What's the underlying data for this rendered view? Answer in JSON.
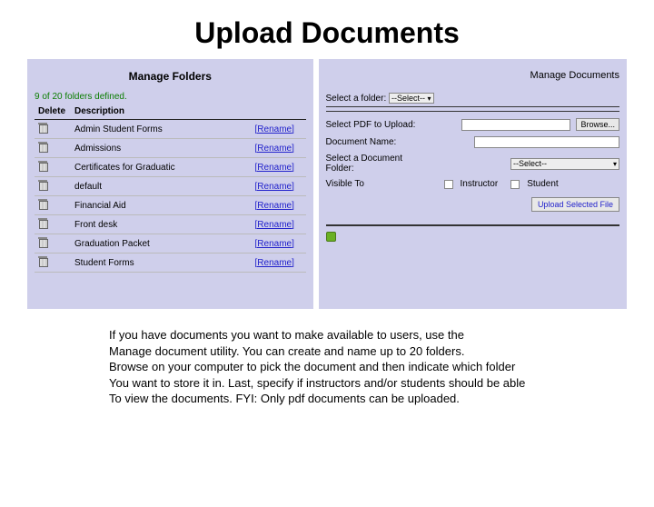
{
  "title": "Upload Documents",
  "left": {
    "heading": "Manage Folders",
    "count_text": "9 of 20 folders defined.",
    "columns": {
      "c0": "Delete",
      "c1": "Description",
      "c2": ""
    },
    "rename_label": "[Rename]",
    "rows": [
      {
        "desc": "Admin Student Forms"
      },
      {
        "desc": "Admissions"
      },
      {
        "desc": "Certificates for Graduatic"
      },
      {
        "desc": "default"
      },
      {
        "desc": "Financial Aid"
      },
      {
        "desc": "Front desk"
      },
      {
        "desc": "Graduation Packet"
      },
      {
        "desc": "Student Forms"
      }
    ]
  },
  "right": {
    "heading": "Manage Documents",
    "select_folder_label": "Select a folder:",
    "select_folder_value": "--Select--",
    "pdf_label": "Select PDF to Upload:",
    "browse_label": "Browse...",
    "docname_label": "Document Name:",
    "docfolder_label": "Select a Document Folder:",
    "docfolder_value": "--Select--",
    "visible_label": "Visible To",
    "chk_instructor": "Instructor",
    "chk_student": "Student",
    "upload_btn": "Upload Selected File"
  },
  "explainer": {
    "l1": "If you have documents you want to make available to users, use the",
    "l2": "Manage document utility.  You can create and name up to 20 folders.",
    "l3": "Browse on your computer to pick the document and then indicate which folder",
    "l4": "You want to store it in.  Last, specify if instructors and/or students should be able",
    "l5": "To view the documents. FYI:  Only pdf documents can be uploaded."
  }
}
